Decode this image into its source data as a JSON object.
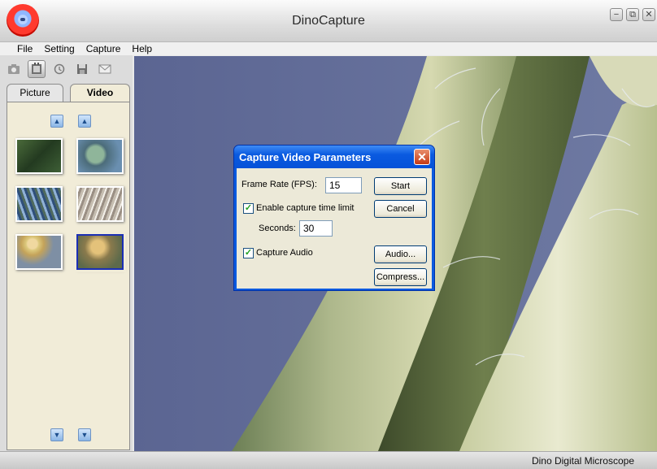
{
  "window": {
    "title": "DinoCapture",
    "controls": [
      "minimize-icon",
      "restore-icon",
      "close-icon"
    ]
  },
  "menu": [
    "File",
    "Setting",
    "Capture",
    "Help"
  ],
  "toolbar": {
    "icons": [
      "camera-icon",
      "video-camera-icon",
      "timer-icon",
      "save-icon",
      "email-icon"
    ],
    "active": "video-camera-icon"
  },
  "tabs": {
    "picture": "Picture",
    "video": "Video",
    "active": "Video"
  },
  "thumbnails": {
    "count": 6,
    "selected_index": 5
  },
  "dialog": {
    "title": "Capture Video Parameters",
    "frame_rate_label": "Frame Rate (FPS):",
    "frame_rate_value": "15",
    "enable_time_limit_label": "Enable capture time limit",
    "enable_time_limit_checked": true,
    "seconds_label": "Seconds:",
    "seconds_value": "30",
    "capture_audio_label": "Capture Audio",
    "capture_audio_checked": true,
    "start_label": "Start",
    "cancel_label": "Cancel",
    "audio_label": "Audio...",
    "compress_label": "Compress..."
  },
  "status": {
    "text": "Dino Digital Microscope"
  },
  "colors": {
    "dialog_title": "#0a5ae0",
    "panel_bg": "#f1ecd8",
    "viewport_bg": "#606a93",
    "selection": "#1b2fb5"
  }
}
